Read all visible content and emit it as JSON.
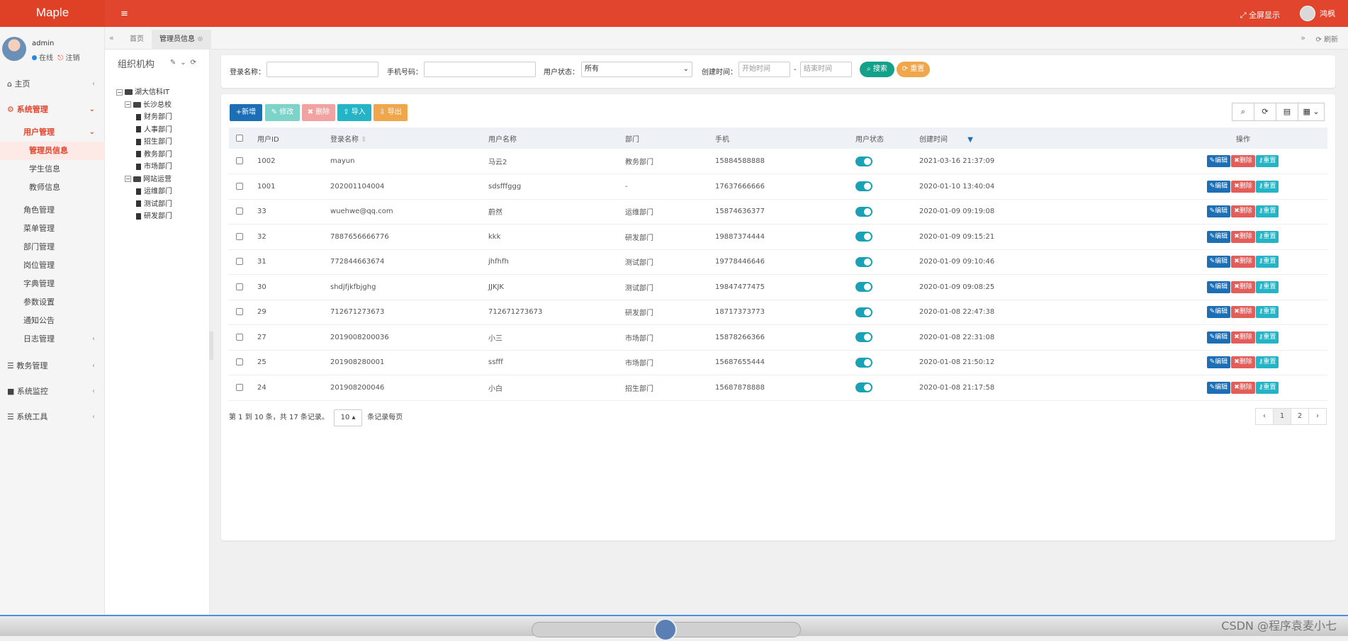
{
  "app": {
    "logo": "Maple",
    "fullscreen": "全屏显示",
    "username": "鸿枫"
  },
  "profile": {
    "name": "admin",
    "online": "在线",
    "logout": "注销"
  },
  "menu": {
    "home": "主页",
    "system": "系统管理",
    "users": "用户管理",
    "admin_info": "管理员信息",
    "student_info": "学生信息",
    "teacher_info": "教师信息",
    "role": "角色管理",
    "menu_mgmt": "菜单管理",
    "dept": "部门管理",
    "post": "岗位管理",
    "dict": "字典管理",
    "params": "参数设置",
    "notice": "通知公告",
    "log": "日志管理",
    "edu": "教务管理",
    "monitor": "系统监控",
    "tools": "系统工具"
  },
  "tabs": {
    "home": "首页",
    "current": "管理员信息",
    "refresh": "刷新"
  },
  "org": {
    "title": "组织机构",
    "tree": [
      {
        "level": 0,
        "type": "folder",
        "label": "湖大信科IT"
      },
      {
        "level": 1,
        "type": "folder",
        "label": "长沙总校"
      },
      {
        "level": 2,
        "type": "file",
        "label": "财务部门"
      },
      {
        "level": 2,
        "type": "file",
        "label": "人事部门"
      },
      {
        "level": 2,
        "type": "file",
        "label": "招生部门"
      },
      {
        "level": 2,
        "type": "file",
        "label": "教务部门"
      },
      {
        "level": 2,
        "type": "file",
        "label": "市场部门"
      },
      {
        "level": 1,
        "type": "folder",
        "label": "网站运营"
      },
      {
        "level": 2,
        "type": "file",
        "label": "运维部门"
      },
      {
        "level": 2,
        "type": "file",
        "label": "测试部门"
      },
      {
        "level": 2,
        "type": "file",
        "label": "研发部门"
      }
    ]
  },
  "search": {
    "login_label": "登录名称：",
    "phone_label": "手机号码：",
    "status_label": "用户状态：",
    "status_value": "所有",
    "created_label": "创建时间：",
    "start_placeholder": "开始时间",
    "end_placeholder": "结束时间",
    "search_btn": "搜索",
    "reset_btn": "重置"
  },
  "toolbar": {
    "add": "+新增",
    "edit": "修改",
    "delete": "删除",
    "import": "导入",
    "export": "导出"
  },
  "table": {
    "headers": [
      "用户ID",
      "登录名称",
      "用户名称",
      "部门",
      "手机",
      "用户状态",
      "创建时间",
      "操作"
    ],
    "rows": [
      {
        "id": "1002",
        "login": "mayun",
        "name": "马云2",
        "dept": "教务部门",
        "phone": "15884588888",
        "created": "2021-03-16 21:37:09"
      },
      {
        "id": "1001",
        "login": "202001104004",
        "name": "sdsfffggg",
        "dept": "-",
        "phone": "17637666666",
        "created": "2020-01-10 13:40:04"
      },
      {
        "id": "33",
        "login": "wuehwe@qq.com",
        "name": "蔚然",
        "dept": "运维部门",
        "phone": "15874636377",
        "created": "2020-01-09 09:19:08"
      },
      {
        "id": "32",
        "login": "7887656666776",
        "name": "kkk",
        "dept": "研发部门",
        "phone": "19887374444",
        "created": "2020-01-09 09:15:21"
      },
      {
        "id": "31",
        "login": "772844663674",
        "name": "jhfhfh",
        "dept": "测试部门",
        "phone": "19778446646",
        "created": "2020-01-09 09:10:46"
      },
      {
        "id": "30",
        "login": "shdjfjkfbjghg",
        "name": "JJKJK",
        "dept": "测试部门",
        "phone": "19847477475",
        "created": "2020-01-09 09:08:25"
      },
      {
        "id": "29",
        "login": "712671273673",
        "name": "712671273673",
        "dept": "研发部门",
        "phone": "18717373773",
        "created": "2020-01-08 22:47:38"
      },
      {
        "id": "27",
        "login": "2019008200036",
        "name": "小三",
        "dept": "市场部门",
        "phone": "15878266366",
        "created": "2020-01-08 22:31:08"
      },
      {
        "id": "25",
        "login": "201908280001",
        "name": "ssfff",
        "dept": "市场部门",
        "phone": "15687655444",
        "created": "2020-01-08 21:50:12"
      },
      {
        "id": "24",
        "login": "201908200046",
        "name": "小白",
        "dept": "招生部门",
        "phone": "15687878888",
        "created": "2020-01-08 21:17:58"
      }
    ],
    "actions": {
      "edit": "编辑",
      "delete": "删除",
      "reset": "重置"
    }
  },
  "pager": {
    "summary": "第 1 到 10 条，共 17 条记录。",
    "page_size": "10",
    "per_page": "条记录每页",
    "pages": [
      "‹",
      "1",
      "2",
      "›"
    ]
  },
  "watermark": "CSDN @程序袁麦小七"
}
